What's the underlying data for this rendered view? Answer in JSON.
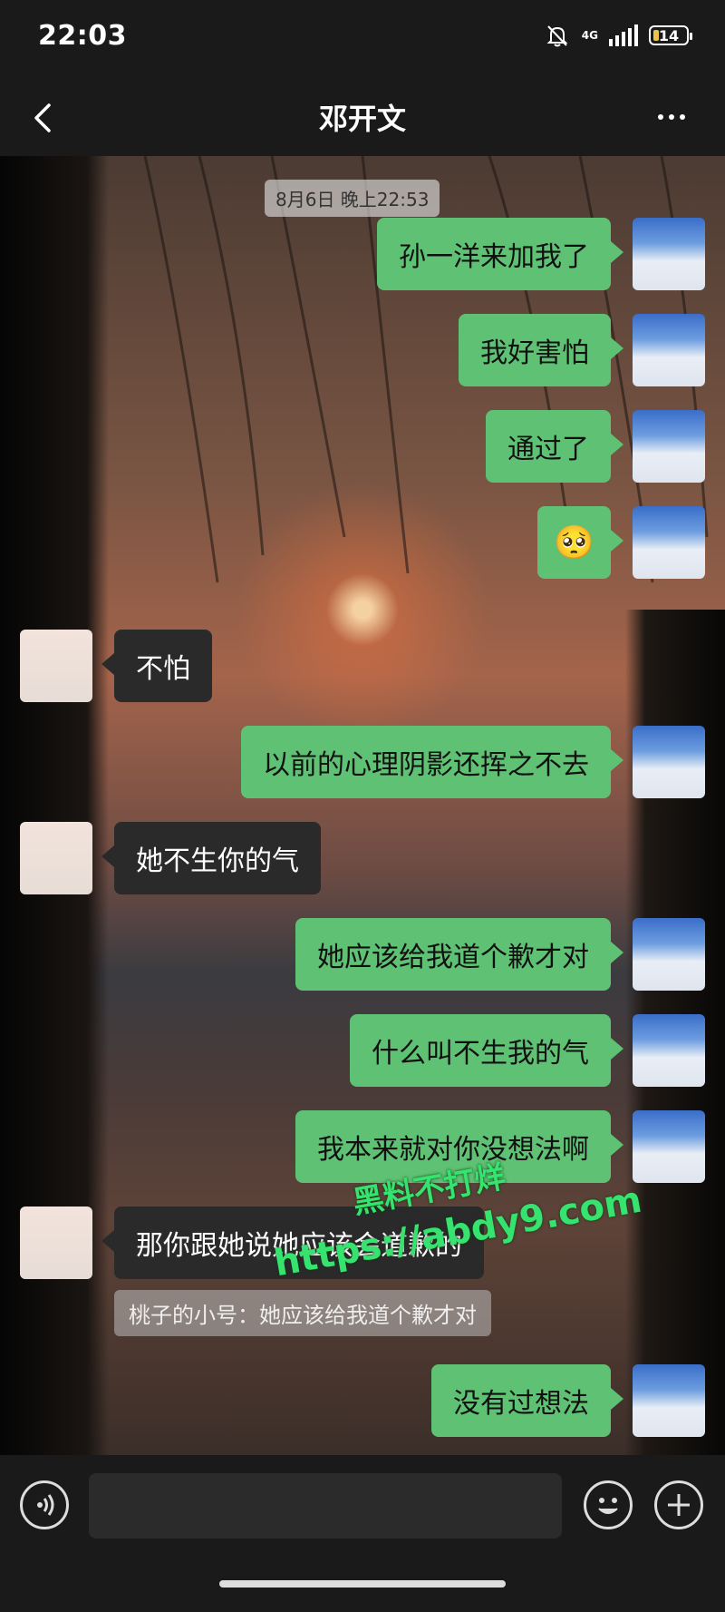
{
  "status_bar": {
    "time": "22:03",
    "network": "4G",
    "battery": "14"
  },
  "header": {
    "title": "邓开文"
  },
  "chat": {
    "timestamp": "8月6日 晚上22:53",
    "messages": [
      {
        "from": "me",
        "text": "孙一洋来加我了"
      },
      {
        "from": "me",
        "text": "我好害怕"
      },
      {
        "from": "me",
        "text": "通过了"
      },
      {
        "from": "me",
        "text": "🥺"
      },
      {
        "from": "other",
        "text": "不怕"
      },
      {
        "from": "me",
        "text": "以前的心理阴影还挥之不去"
      },
      {
        "from": "other",
        "text": "她不生你的气"
      },
      {
        "from": "me",
        "text": "她应该给我道个歉才对"
      },
      {
        "from": "me",
        "text": "什么叫不生我的气"
      },
      {
        "from": "me",
        "text": "我本来就对你没想法啊"
      },
      {
        "from": "other",
        "text": "那你跟她说她应该会道歉的"
      },
      {
        "from": "me",
        "text": "没有过想法"
      }
    ],
    "quote": "桃子的小号：她应该给我道个歉才对"
  },
  "watermark": {
    "line1": "黑料不打烊",
    "line2": "https://abdy9.com"
  },
  "input_bar": {
    "placeholder": ""
  },
  "icons": {
    "back": "chevron-left-icon",
    "more": "more-icon",
    "voice": "voice-icon",
    "emoji": "emoji-icon",
    "plus": "plus-icon",
    "mute": "bell-off-icon"
  },
  "colors": {
    "my_bubble": "#5fc174",
    "other_bubble": "#2a2a2a",
    "bar": "#1a1a1a",
    "watermark": "#37e36f"
  }
}
